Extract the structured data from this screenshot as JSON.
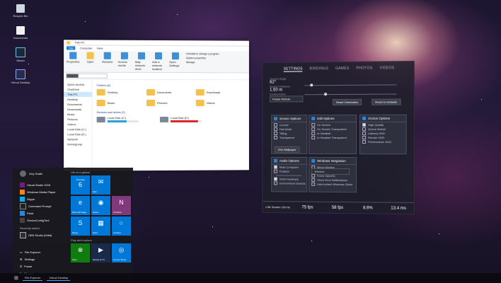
{
  "desktop": {
    "icons": [
      "Recycle Bin",
      "Documents",
      "Steam",
      "Virtual Desktop"
    ]
  },
  "explorer": {
    "tabs": [
      "File",
      "Computer",
      "View"
    ],
    "ribbon": [
      "Properties",
      "Open",
      "Rename",
      "Access media",
      "Map network drive",
      "Add a network location",
      "Open Settings",
      "Uninstall or change a program",
      "System properties",
      "Manage"
    ],
    "address": "This PC",
    "nav": [
      "Quick access",
      "OneDrive",
      "This PC",
      "Desktop",
      "Documents",
      "Downloads",
      "Music",
      "Pictures",
      "Videos",
      "Local Disk (C:)",
      "Local Disk (D:)",
      "Network",
      "Homegroup"
    ],
    "folders_header": "Folders (6)",
    "folders": [
      "Desktop",
      "Documents",
      "Downloads",
      "Music",
      "Pictures",
      "Videos"
    ],
    "drives_header": "Devices and drives (2)",
    "drives": [
      {
        "name": "Local Disk (C:)",
        "fill": 0.62,
        "color": "blue"
      },
      {
        "name": "Local Disk (D:)",
        "fill": 0.88,
        "color": "red"
      }
    ],
    "status": "8 items"
  },
  "start": {
    "user": "Guy Godin",
    "most_used": [
      "Visual Studio 2015",
      "Windows Media Player",
      "Skype",
      "Command Prompt",
      "Paint",
      "OculusConfigTool"
    ],
    "recently_added_label": "Recently added",
    "recently_added": [
      "OBS Studio (64bit)"
    ],
    "bottom": [
      "File Explorer",
      "Settings",
      "Power",
      "All apps"
    ],
    "life_label": "Life at a glance",
    "play_label": "Play and explore",
    "calendar_day": "Thursday",
    "calendar_date": "6",
    "tiles": [
      "Mail",
      "Microsoft Edge",
      "Steam",
      "OneNote",
      "Skype",
      "Store",
      "Cortana",
      "Xbox",
      "Movies & TV",
      "Groove Music"
    ]
  },
  "taskbar": [
    "File Explorer",
    "Virtual Desktop"
  ],
  "panel": {
    "tabs": [
      "SETTINGS",
      "BINDINGS",
      "GAMES",
      "PHOTOS",
      "VIDEOS"
    ],
    "active_tab": "SETTINGS",
    "fov_label": "Screen Angle",
    "fov_value": "62°",
    "dist_label": "Screen Distance",
    "dist_value": "1.50 m",
    "env_label": "Environment",
    "env_value": "Purple Nebula",
    "reset_orientation": "Reset Orientation",
    "reset_defaults": "Reset to Defaults",
    "screen_options": {
      "title": "Screen Options",
      "items": [
        "Curved",
        "Flat Mode",
        "Tilting",
        "Transparent"
      ],
      "checked": [
        false,
        false,
        false,
        false
      ],
      "button": "Dim Wallpaper"
    },
    "edit_options": {
      "title": "Edit Options",
      "items": [
        "On Screen",
        "On Screen Transparent",
        "In Headset",
        "In Headset Transparent"
      ],
      "checked": [
        false,
        false,
        false,
        false
      ]
    },
    "oculus_options": {
      "title": "Oculus Options",
      "items": [
        "High Quality",
        "Queue Ahead",
        "Latency HUD",
        "Render HUD",
        "Performance HUD"
      ],
      "checked": [
        true,
        false,
        false,
        false,
        false
      ]
    },
    "audio_options": {
      "title": "Audio Options",
      "items": [
        "Mute Computer",
        "Position",
        "Vivid Feedback",
        "Environment Sounds"
      ],
      "checked": [
        true,
        false,
        true,
        false
      ]
    },
    "windows_integration": {
      "title": "Windows Integration",
      "items": [
        "Mirror Monitor",
        "Window",
        "Force OpenGL",
        "Show Error Notifications",
        "Hand wheel Windows Clicks"
      ],
      "checked": [
        false,
        false,
        false,
        false,
        false
      ]
    },
    "stats": [
      "1.5K Screen 120 Hz",
      "75 fps",
      "58 fps",
      "8.6%",
      "13.4 ms"
    ]
  }
}
